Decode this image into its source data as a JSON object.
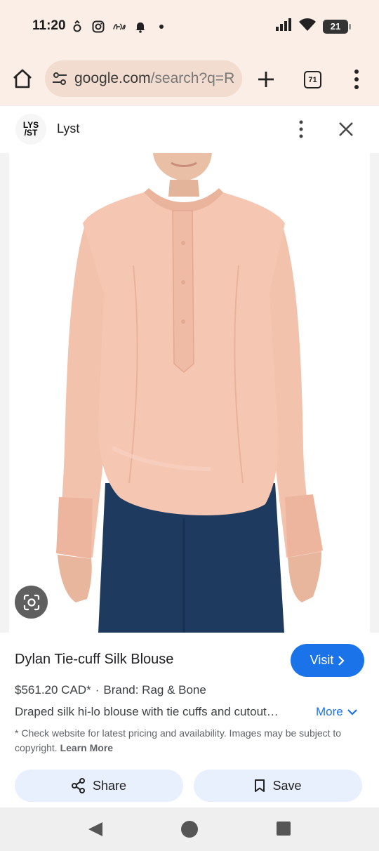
{
  "status_bar": {
    "time": "11:20",
    "battery": "21",
    "icons_left": [
      "threads-icon",
      "instagram-icon",
      "app-icon",
      "notification-bell-icon",
      "dot-icon"
    ],
    "icons_right": [
      "signal-icon",
      "wifi-icon",
      "battery-icon"
    ]
  },
  "browser": {
    "url_main": "google.com",
    "url_rest": "/search?q=R",
    "tab_count": "71"
  },
  "panel": {
    "site_name": "Lyst",
    "logo_text_line1": "LYS",
    "logo_text_line2": "/ST"
  },
  "product": {
    "title": "Dylan Tie-cuff Silk Blouse",
    "visit_label": "Visit",
    "price": "$561.20 CAD*",
    "separator": "·",
    "brand": "Brand: Rag & Bone",
    "description": "Draped silk hi-lo blouse with tie cuffs and cutout…",
    "more_label": "More",
    "disclaimer": "* Check website for latest pricing and availability. Images may be subject to copyright.",
    "learn_more": "Learn More",
    "share_label": "Share",
    "save_label": "Save"
  },
  "colors": {
    "chrome_bg": "#fbeee6",
    "url_bar_bg": "#f2dccf",
    "accent_blue": "#1a73e8",
    "action_bg": "#e8f0fe",
    "blouse": "#f4c3ad",
    "jeans": "#1f3a5f"
  }
}
